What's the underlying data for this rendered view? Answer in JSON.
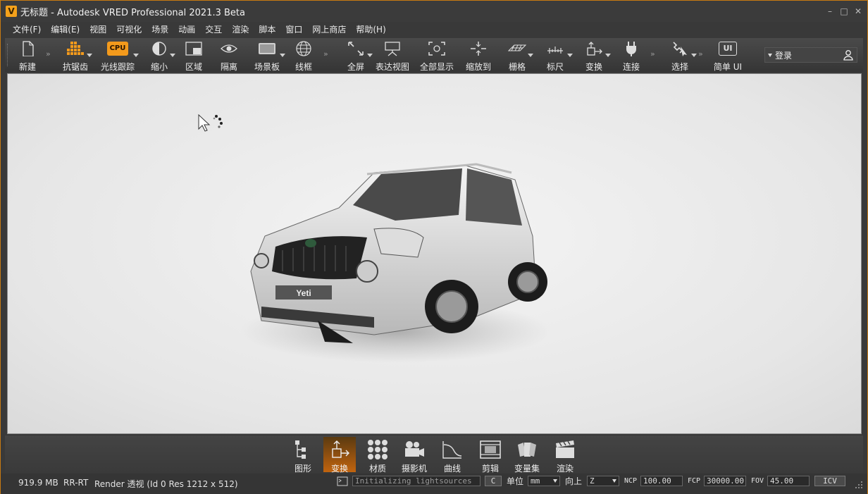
{
  "window": {
    "title": "无标题 - Autodesk VRED Professional 2021.3 Beta",
    "logo_letter": "V",
    "accent_color": "#f4a11b"
  },
  "menu": [
    "文件(F)",
    "编辑(E)",
    "视图",
    "可视化",
    "场景",
    "动画",
    "交互",
    "渲染",
    "脚本",
    "窗口",
    "网上商店",
    "帮助(H)"
  ],
  "toolbar": {
    "new": "新建",
    "antialias": "抗锯齿",
    "raytracing": "光线跟踪",
    "raytracing_badge": "CPU",
    "shrink": "缩小",
    "region": "区域",
    "isolate": "隔离",
    "scene_panel": "场景板",
    "wireframe": "线框",
    "fullscreen": "全屏",
    "presentation": "表达视图",
    "show_all": "全部显示",
    "zoom_to": "缩放到",
    "grid": "栅格",
    "ruler": "标尺",
    "transform": "变换",
    "connect": "连接",
    "select": "选择",
    "simple_ui": "简单 UI",
    "simple_ui_badge": "UI"
  },
  "login": {
    "label": "登录"
  },
  "dock": [
    "图形",
    "变换",
    "材质",
    "摄影机",
    "曲线",
    "剪辑",
    "变量集",
    "渲染"
  ],
  "dock_active": "变换",
  "car": {
    "plate": "Yeti"
  },
  "status": {
    "memory": "919.9 MB",
    "mode": "RR-RT",
    "render_info": "Render 透视 (Id 0 Res 1212 x 512)",
    "message": "Initializing lightsources",
    "clear_button": "C",
    "unit_label": "单位",
    "unit_value": "mm",
    "up_label": "向上",
    "up_value": "Z",
    "ncp_label": "NCP",
    "ncp_value": "100.00",
    "fcp_label": "FCP",
    "fcp_value": "30000.00",
    "fov_label": "FOV",
    "fov_value": "45.00",
    "icv_button": "ICV"
  }
}
